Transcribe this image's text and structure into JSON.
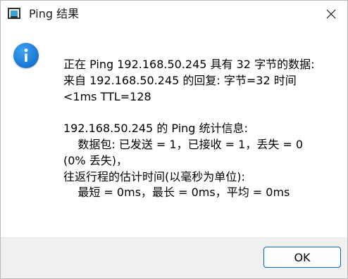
{
  "window": {
    "title": "Ping 结果"
  },
  "icons": {
    "app": "app-window-icon",
    "close": "close-icon",
    "info": "info-icon"
  },
  "message": {
    "lines": [
      "正在 Ping 192.168.50.245 具有 32 字节的数据:",
      "来自 192.168.50.245 的回复: 字节=32 时间",
      "<1ms TTL=128",
      "",
      "192.168.50.245 的 Ping 统计信息:",
      "    数据包: 已发送 = 1，已接收 = 1，丢失 = 0",
      "(0% 丢失)，",
      "往返行程的估计时间(以毫秒为单位):",
      "    最短 = 0ms，最长 = 0ms，平均 = 0ms"
    ]
  },
  "buttons": {
    "ok_label": "OK"
  },
  "colors": {
    "info_blue": "#1f7fd9",
    "button_border": "#0067c0",
    "footer_bg": "#f0f0f0"
  }
}
